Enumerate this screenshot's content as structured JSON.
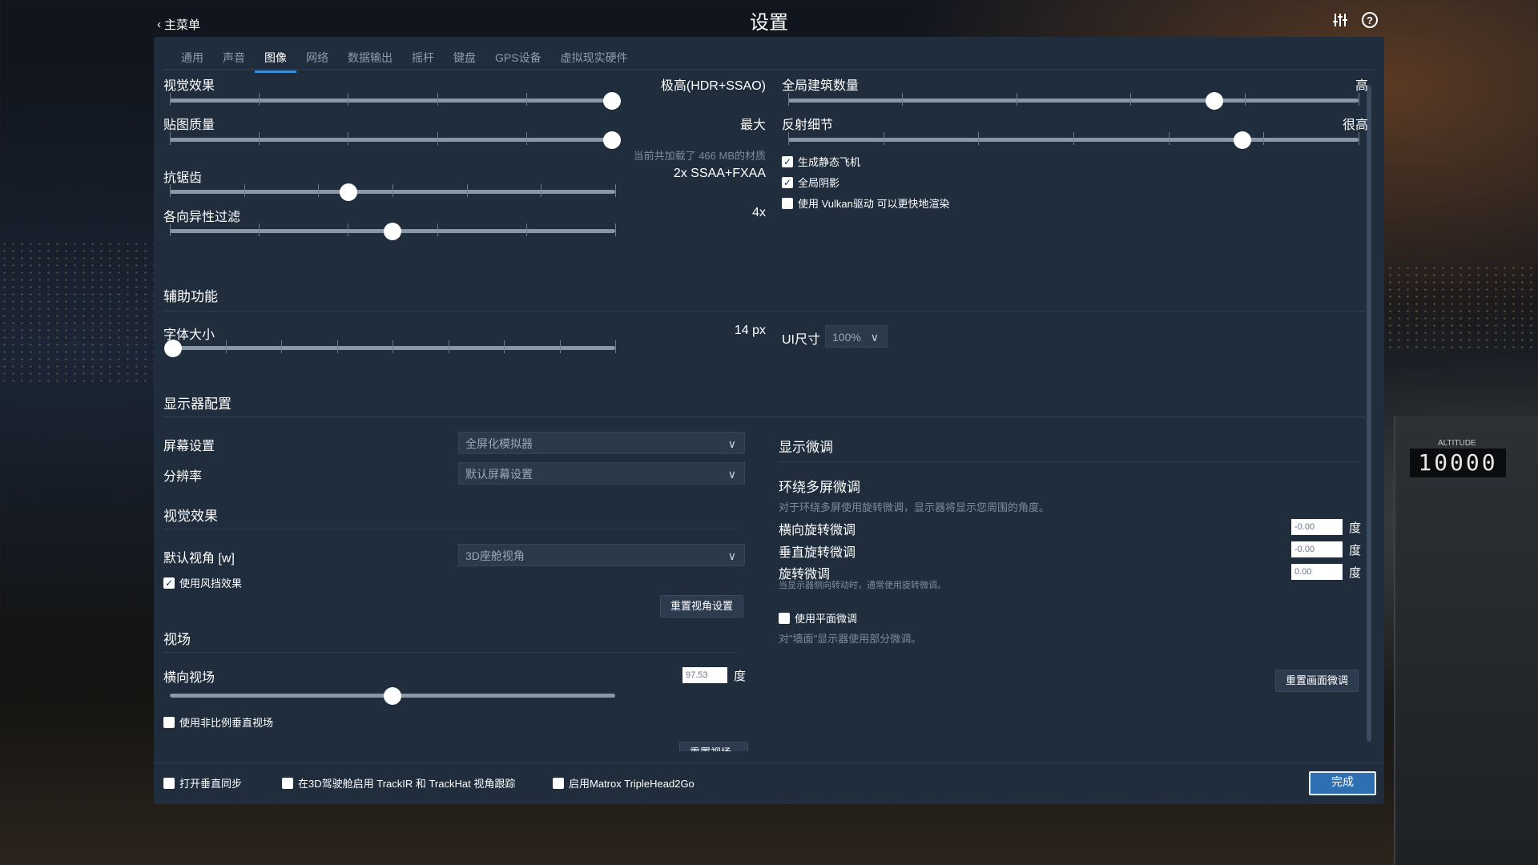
{
  "header": {
    "title": "设置",
    "back_label": "主菜单"
  },
  "tabs": [
    "通用",
    "声音",
    "图像",
    "网络",
    "数据输出",
    "摇杆",
    "键盘",
    "GPS设备",
    "虚拟现实硬件"
  ],
  "sliders_left": [
    {
      "label": "视觉效果",
      "value": "极高(HDR+SSAO)",
      "level": 1.0
    },
    {
      "label": "贴图质量",
      "value": "最大",
      "level": 1.0,
      "note": "当前共加载了 466 MB的材质"
    },
    {
      "label": "抗锯齿",
      "value": "2x SSAA+FXAA",
      "level": 0.4
    },
    {
      "label": "各向异性过滤",
      "value": "4x",
      "level": 0.5
    }
  ],
  "sliders_right": [
    {
      "label": "全局建筑数量",
      "value": "高",
      "level": 0.75
    },
    {
      "label": "反射细节",
      "value": "很高",
      "level": 0.8
    }
  ],
  "graphics_checks": [
    {
      "label": "生成静态飞机",
      "checked": true
    },
    {
      "label": "全局阴影",
      "checked": true
    },
    {
      "label": "使用 Vulkan驱动 可以更快地渲染",
      "checked": false
    }
  ],
  "accessibility": {
    "title": "辅助功能",
    "font_label": "字体大小",
    "font_value": "14 px",
    "font_level": 0.0,
    "ui_label": "UI尺寸",
    "ui_value": "100%"
  },
  "monitor": {
    "title": "显示器配置",
    "screen_label": "屏幕设置",
    "screen_value": "全屏化模拟器",
    "res_label": "分辨率",
    "res_value": "默认屏幕设置"
  },
  "visual": {
    "title": "视觉效果",
    "view_label": "默认视角 [w]",
    "view_value": "3D座舱视角",
    "windshield_label": "使用风挡效果",
    "windshield_checked": true,
    "reset_view_button": "重置视角设置"
  },
  "fov": {
    "title": "视场",
    "hfov_label": "横向视场",
    "hfov_value": "97.53",
    "unit": "度",
    "level": 0.5,
    "nonprop_label": "使用非比例垂直视场",
    "reset_button": "重置视场"
  },
  "tuning": {
    "title": "显示微调",
    "wrap_title": "环绕多屏微调",
    "wrap_note": "对于环绕多屏使用旋转微调，显示器将显示您周围的角度。",
    "rows": [
      {
        "label": "横向旋转微调",
        "value": "-0.00",
        "unit": "度"
      },
      {
        "label": "垂直旋转微调",
        "value": "-0.00",
        "unit": "度"
      },
      {
        "label": "旋转微调",
        "value": "0.00",
        "unit": "度"
      }
    ],
    "rotate_note": "当显示器侧向转动时，通常使用旋转微调。",
    "flat_label": "使用平面微调",
    "flat_note": "对\"墙面\"显示器使用部分微调。",
    "reset_button": "重置画面微调"
  },
  "footer": {
    "vsync": "打开垂直同步",
    "trackir": "在3D驾驶舱启用 TrackIR 和 TrackHat 视角跟踪",
    "matrox": "启用Matrox TripleHead2Go",
    "done": "完成"
  },
  "background": {
    "altitude_label": "ALTITUDE",
    "altitude_value": "10000"
  }
}
